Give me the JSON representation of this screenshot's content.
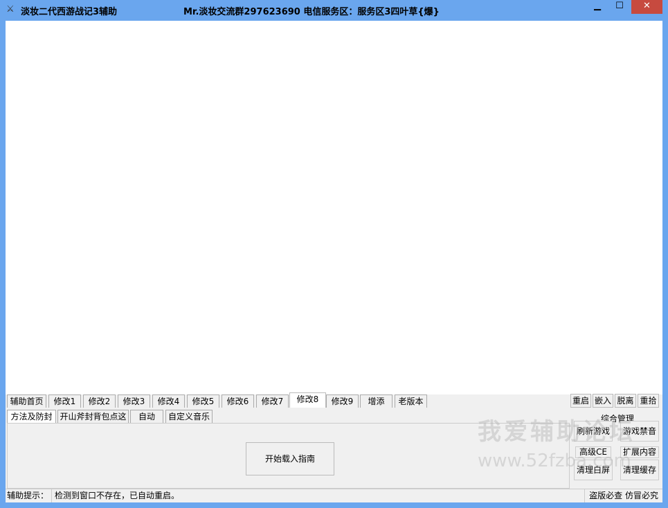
{
  "window": {
    "title": "淡妆二代西游战记3辅助",
    "info": "Mr.淡妆交流群297623690  电信服务区：服务区3四叶草{爆}",
    "minimize": "▁",
    "maximize": "☐",
    "close": "✕"
  },
  "tabs": [
    {
      "label": "辅助首页"
    },
    {
      "label": "修改1"
    },
    {
      "label": "修改2"
    },
    {
      "label": "修改3"
    },
    {
      "label": "修改4"
    },
    {
      "label": "修改5"
    },
    {
      "label": "修改6"
    },
    {
      "label": "修改7"
    },
    {
      "label": "修改8"
    },
    {
      "label": "修改9"
    },
    {
      "label": "增添"
    },
    {
      "label": "老版本"
    }
  ],
  "subtabs": [
    {
      "label": "方法及防封"
    },
    {
      "label": "开山斧封背包点这"
    },
    {
      "label": "自动"
    },
    {
      "label": "自定义音乐"
    }
  ],
  "panel": {
    "start_button": "开始载入指南"
  },
  "right": {
    "restart": "重启",
    "embed": "嵌入",
    "detach": "脱离",
    "reshoot": "重拾",
    "group_title": "综合管理",
    "refresh": "刷新游戏",
    "mute": "游戏禁音",
    "ce": "高级CE",
    "expand": "扩展内容",
    "clear_white": "清理白屏",
    "clear_cache": "清理缓存"
  },
  "status": {
    "label": "辅助提示：",
    "message": "检测到窗口不存在，已自动重启。",
    "right": "盗版必查  仿冒必究"
  },
  "watermark": {
    "line1": "我爱辅助论坛",
    "line2": "www.52fzba.com"
  }
}
